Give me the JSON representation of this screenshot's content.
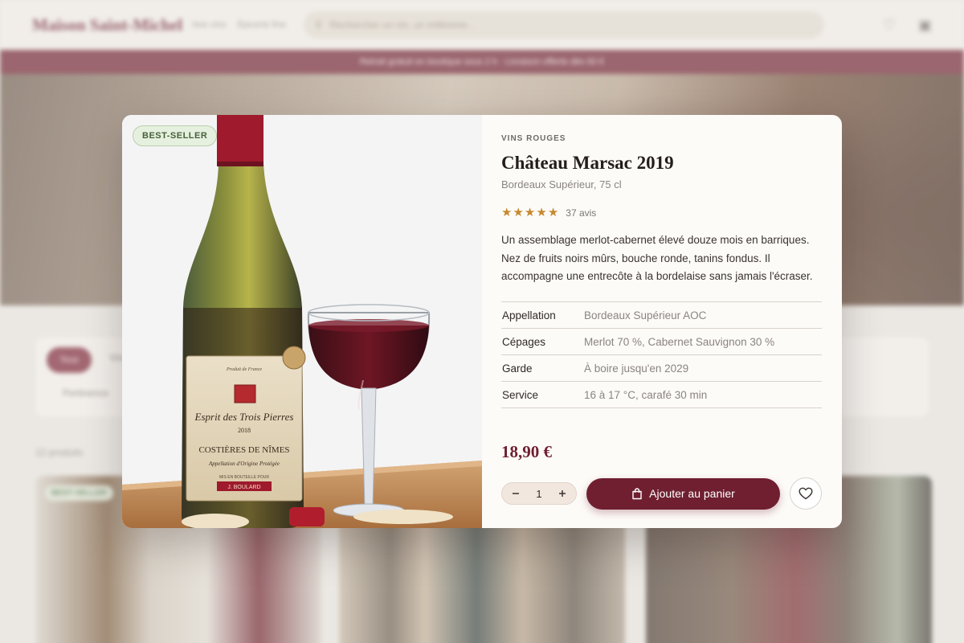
{
  "background": {
    "brand": "Maison Saint-Michel",
    "nav": [
      "Nos vins",
      "Épicerie fine"
    ],
    "search_placeholder": "Rechercher un vin, un millésime…",
    "promo": "Retrait gratuit en boutique sous 2 h · Livraison offerte dès 60 €",
    "filter_active": "Tous",
    "filter_option": "Vins",
    "filter_sub": "Pertinence",
    "count": "12 produits",
    "card_badge": "BEST-SELLER"
  },
  "modal": {
    "badge": "BEST-SELLER",
    "category": "VINS ROUGES",
    "title": "Château Marsac 2019",
    "subtitle": "Bordeaux Supérieur, 75 cl",
    "rating_stars": 5,
    "reviews": "37 avis",
    "description": "Un assemblage merlot-cabernet élevé douze mois en barriques. Nez de fruits noirs mûrs, bouche ronde, tanins fondus. Il accompagne une entrecôte à la bordelaise sans jamais l'écraser.",
    "specs": [
      {
        "label": "Appellation",
        "value": "Bordeaux Supérieur AOC"
      },
      {
        "label": "Cépages",
        "value": "Merlot 70 %, Cabernet Sauvignon 30 %"
      },
      {
        "label": "Garde",
        "value": "À boire jusqu'en 2029"
      },
      {
        "label": "Service",
        "value": "16 à 17 °C, carafé 30 min"
      }
    ],
    "price": "18,90 €",
    "quantity": "1",
    "add_to_cart": "Ajouter au panier",
    "bottle_label": {
      "top": "Produit de France",
      "name": "Esprit des Trois Pierres",
      "vintage": "2018",
      "appellation": "COSTIÈRES DE NÎMES",
      "aoc": "Appellation d'Origine Protégée",
      "bottled": "MIS EN BOUTEILLE POUR",
      "producer": "J. BOULARD"
    }
  },
  "colors": {
    "accent": "#6f1f30",
    "badge_green": "#45603a",
    "star": "#c58a2e"
  }
}
